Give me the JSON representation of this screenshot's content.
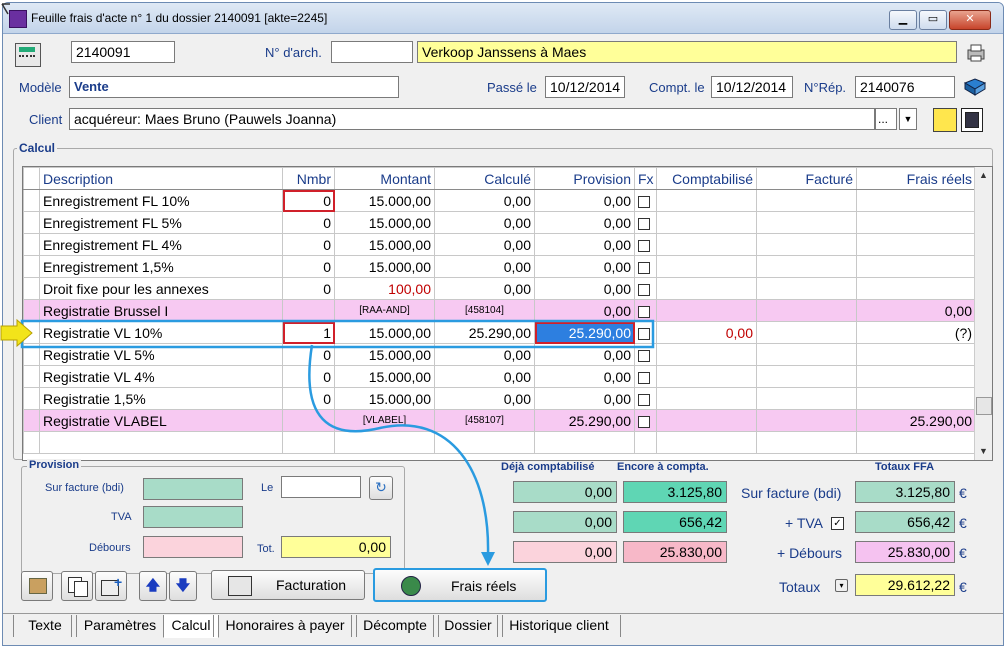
{
  "window": {
    "title": "Feuille frais d'acte n° 1 du dossier 2140091 [akte=2245]"
  },
  "header": {
    "dossier": "2140091",
    "archive_label": "N° d'arch.",
    "archive_value": "",
    "description": "Verkoop Janssens à Maes",
    "model_label": "Modèle",
    "model_value": "Vente",
    "passe_label": "Passé le",
    "passe_value": "10/12/2014",
    "compt_label": "Compt. le",
    "compt_value": "10/12/2014",
    "rep_label": "N°Rép.",
    "rep_value": "2140076",
    "client_label": "Client",
    "client_value": "acquéreur: Maes Bruno (Pauwels Joanna)",
    "client_dots": "..."
  },
  "calcul": {
    "group_label": "Calcul",
    "columns": [
      "Description",
      "Nmbr",
      "Montant",
      "Calculé",
      "Provision",
      "Fx",
      "Comptabilisé",
      "Facturé",
      "Frais réels"
    ],
    "rows": [
      {
        "desc": "Enregistrement FL 10%",
        "nmbr": "0",
        "montant": "15.000,00",
        "calcule": "0,00",
        "provision": "0,00",
        "compta": "",
        "facture": "",
        "frais": "",
        "pink": false
      },
      {
        "desc": "Enregistrement FL 5%",
        "nmbr": "0",
        "montant": "15.000,00",
        "calcule": "0,00",
        "provision": "0,00",
        "compta": "",
        "facture": "",
        "frais": "",
        "pink": false
      },
      {
        "desc": "Enregistrement FL 4%",
        "nmbr": "0",
        "montant": "15.000,00",
        "calcule": "0,00",
        "provision": "0,00",
        "compta": "",
        "facture": "",
        "frais": "",
        "pink": false
      },
      {
        "desc": "Enregistrement 1,5%",
        "nmbr": "0",
        "montant": "15.000,00",
        "calcule": "0,00",
        "provision": "0,00",
        "compta": "",
        "facture": "",
        "frais": "",
        "pink": false
      },
      {
        "desc": "Droit fixe pour les annexes",
        "nmbr": "0",
        "montant": "100,00",
        "calcule": "0,00",
        "provision": "0,00",
        "compta": "",
        "facture": "",
        "frais": "",
        "pink": false
      },
      {
        "desc": "Registratie Brussel I",
        "nmbr": "",
        "montant": "[RAA-AND]",
        "calcule": "[458104]",
        "provision": "0,00",
        "compta": "",
        "facture": "",
        "frais": "0,00",
        "pink": true
      },
      {
        "desc": "Registratie VL 10%",
        "nmbr": "1",
        "montant": "15.000,00",
        "calcule": "25.290,00",
        "provision": "25.290,00",
        "compta": "0,00",
        "facture": "",
        "frais": "(?)",
        "pink": false
      },
      {
        "desc": "Registratie VL 5%",
        "nmbr": "0",
        "montant": "15.000,00",
        "calcule": "0,00",
        "provision": "0,00",
        "compta": "",
        "facture": "",
        "frais": "",
        "pink": false
      },
      {
        "desc": "Registratie VL 4%",
        "nmbr": "0",
        "montant": "15.000,00",
        "calcule": "0,00",
        "provision": "0,00",
        "compta": "",
        "facture": "",
        "frais": "",
        "pink": false
      },
      {
        "desc": "Registratie 1,5%",
        "nmbr": "0",
        "montant": "15.000,00",
        "calcule": "0,00",
        "provision": "0,00",
        "compta": "",
        "facture": "",
        "frais": "",
        "pink": false
      },
      {
        "desc": "Registratie VLABEL",
        "nmbr": "",
        "montant": "[VLABEL]",
        "calcule": "[458107]",
        "provision": "25.290,00",
        "compta": "",
        "facture": "",
        "frais": "25.290,00",
        "pink": true
      }
    ]
  },
  "provision": {
    "group_label": "Provision",
    "sur_facture_label": "Sur facture (bdi)",
    "tva_label": "TVA",
    "debours_label": "Débours",
    "le_label": "Le",
    "le_value": "",
    "tot_label": "Tot.",
    "tot_value": "0,00"
  },
  "totals": {
    "deja_label": "Déjà comptabilisé",
    "encore_label": "Encore à compta.",
    "ffa_label": "Totaux FFA",
    "deja": [
      "0,00",
      "0,00",
      "0,00"
    ],
    "encore": [
      "3.125,80",
      "656,42",
      "25.830,00"
    ],
    "ffa": [
      "3.125,80",
      "656,42",
      "25.830,00"
    ],
    "row_labels": [
      "Sur facture (bdi)",
      "+ TVA",
      "+ Débours"
    ],
    "totaux_label": "Totaux",
    "totaux_value": "29.612,22",
    "currency": "€"
  },
  "buttons": {
    "facturation": "Facturation",
    "frais_reels": "Frais réels"
  },
  "tabs": [
    "Texte",
    "Paramètres",
    "Calcul",
    "Honoraires à payer",
    "Décompte",
    "Dossier",
    "Historique client"
  ],
  "colors": {
    "highlight_blue": "#2a9be0",
    "pink_row": "#f7c9f2",
    "yellow_field": "#ffff99",
    "green_field": "#a8dcc8",
    "pink_field": "#fbd3dc",
    "selected_cell": "#2d7fe0"
  }
}
